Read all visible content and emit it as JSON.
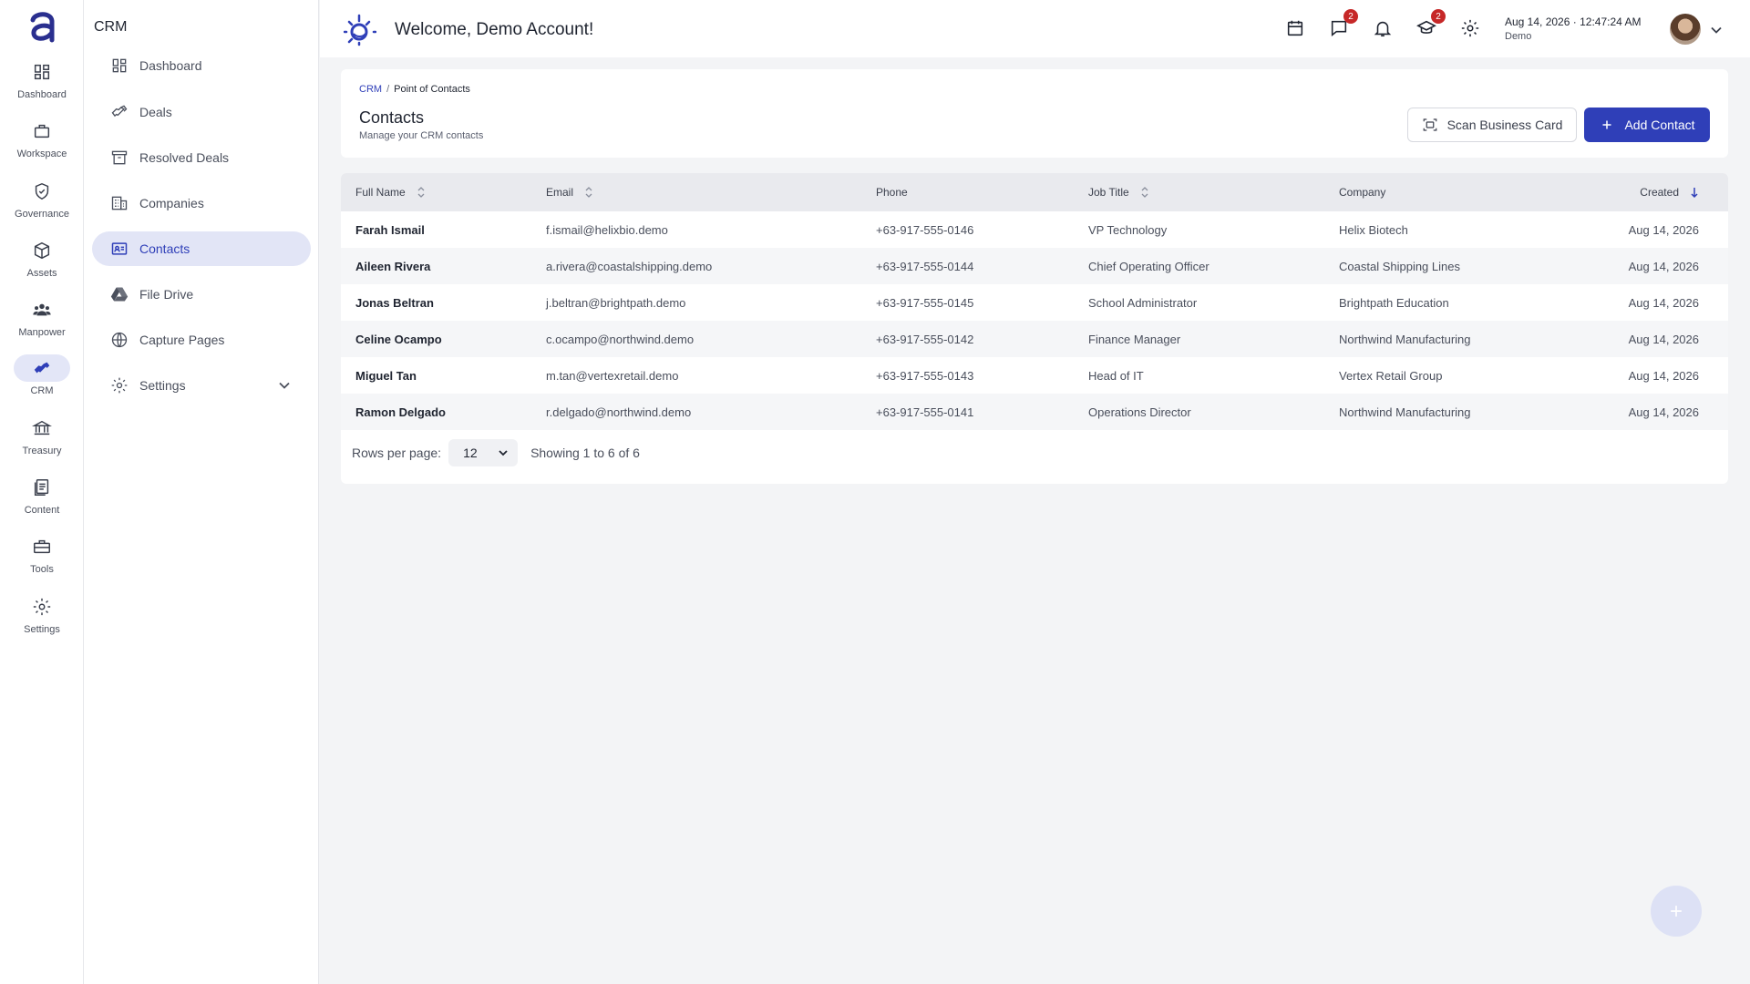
{
  "rail": {
    "items": [
      {
        "label": "Dashboard",
        "icon": "dashboard-icon"
      },
      {
        "label": "Workspace",
        "icon": "briefcase-icon"
      },
      {
        "label": "Governance",
        "icon": "shield-icon"
      },
      {
        "label": "Assets",
        "icon": "cube-icon"
      },
      {
        "label": "Manpower",
        "icon": "people-icon"
      },
      {
        "label": "CRM",
        "icon": "handshake-icon",
        "active": true
      },
      {
        "label": "Treasury",
        "icon": "bank-icon"
      },
      {
        "label": "Content",
        "icon": "documents-icon"
      },
      {
        "label": "Tools",
        "icon": "toolbox-icon"
      },
      {
        "label": "Settings",
        "icon": "gear-icon"
      }
    ]
  },
  "sidebar": {
    "title": "CRM",
    "items": [
      {
        "label": "Dashboard",
        "icon": "dashboard-icon"
      },
      {
        "label": "Deals",
        "icon": "handshake-icon"
      },
      {
        "label": "Resolved Deals",
        "icon": "archive-icon"
      },
      {
        "label": "Companies",
        "icon": "building-icon"
      },
      {
        "label": "Contacts",
        "icon": "contact-card-icon",
        "active": true
      },
      {
        "label": "File Drive",
        "icon": "drive-icon"
      },
      {
        "label": "Capture Pages",
        "icon": "globe-icon"
      },
      {
        "label": "Settings",
        "icon": "gear-icon",
        "expandable": true
      }
    ]
  },
  "header": {
    "welcome": "Welcome, Demo Account!",
    "date": "Aug 14, 2026",
    "time": "12:47:24 AM",
    "date_sep": "·",
    "user": "Demo",
    "messages_badge": "2",
    "learning_badge": "2"
  },
  "page": {
    "breadcrumb_root": "CRM",
    "breadcrumb_sep": "/",
    "breadcrumb_current": "Point of Contacts",
    "title": "Contacts",
    "subtitle": "Manage your CRM contacts",
    "scan_label": "Scan Business Card",
    "add_label": "Add Contact"
  },
  "table": {
    "columns": [
      "Full Name",
      "Email",
      "Phone",
      "Job Title",
      "Company",
      "Created"
    ],
    "rows": [
      [
        "Farah Ismail",
        "f.ismail@helixbio.demo",
        "+63-917-555-0146",
        "VP Technology",
        "Helix Biotech",
        "Aug 14, 2026"
      ],
      [
        "Aileen Rivera",
        "a.rivera@coastalshipping.demo",
        "+63-917-555-0144",
        "Chief Operating Officer",
        "Coastal Shipping Lines",
        "Aug 14, 2026"
      ],
      [
        "Jonas Beltran",
        "j.beltran@brightpath.demo",
        "+63-917-555-0145",
        "School Administrator",
        "Brightpath Education",
        "Aug 14, 2026"
      ],
      [
        "Celine Ocampo",
        "c.ocampo@northwind.demo",
        "+63-917-555-0142",
        "Finance Manager",
        "Northwind Manufacturing",
        "Aug 14, 2026"
      ],
      [
        "Miguel Tan",
        "m.tan@vertexretail.demo",
        "+63-917-555-0143",
        "Head of IT",
        "Vertex Retail Group",
        "Aug 14, 2026"
      ],
      [
        "Ramon Delgado",
        "r.delgado@northwind.demo",
        "+63-917-555-0141",
        "Operations Director",
        "Northwind Manufacturing",
        "Aug 14, 2026"
      ]
    ]
  },
  "pager": {
    "rows_label": "Rows per page:",
    "rows_value": "12",
    "showing": "Showing 1 to 6 of 6"
  },
  "colors": {
    "accent": "#2f3fb8",
    "active_bg": "#e2e5f6",
    "badge": "#c62828"
  }
}
